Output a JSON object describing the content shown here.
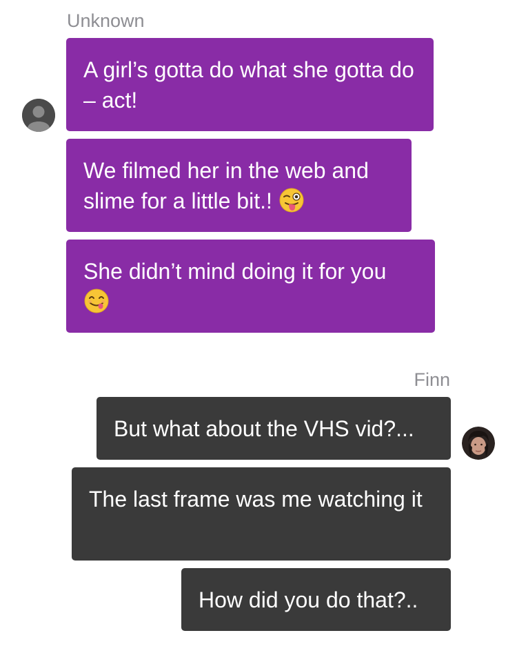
{
  "conversation": {
    "incoming_sender": "Unknown",
    "outgoing_sender": "Finn",
    "incoming": [
      {
        "text": "A girl’s gotta do what she gotta do – act!"
      },
      {
        "text": "We filmed her in the web and slime for a little bit.!",
        "emoji": "winking-tongue-face"
      },
      {
        "text": "She didn’t mind doing it for you",
        "emoji": "smiling-face-with-tongue"
      }
    ],
    "outgoing": [
      {
        "text": "But what about the VHS vid?..."
      },
      {
        "text": "The last frame was me watching it"
      },
      {
        "text": "How did you do that?.."
      }
    ]
  },
  "colors": {
    "incoming_bubble": "#892ca6",
    "outgoing_bubble": "#3a3a3a",
    "sender_label": "#8e8e93",
    "background": "#ffffff"
  },
  "icons": {
    "incoming_avatar": "default-person-avatar-icon",
    "outgoing_avatar": "finn-profile-photo"
  }
}
